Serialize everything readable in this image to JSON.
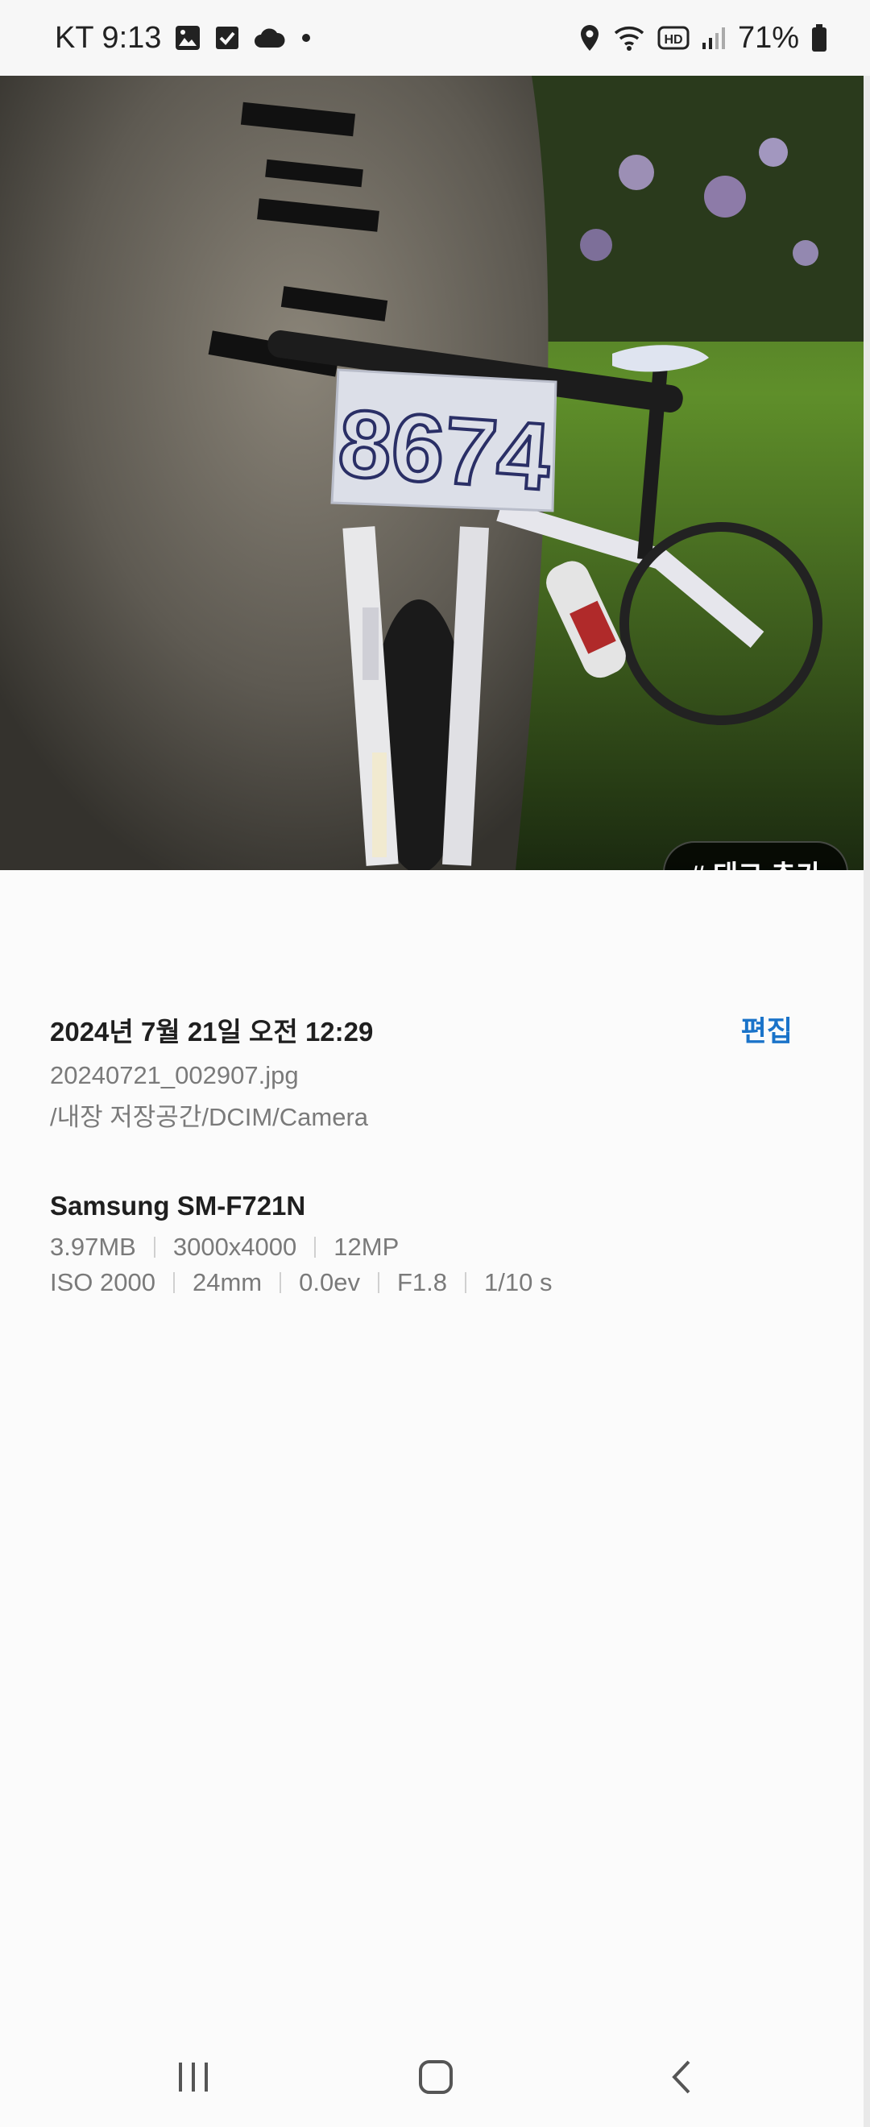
{
  "status_bar": {
    "carrier_time": "KT 9:13",
    "battery_percent": "71%",
    "icons": [
      "gallery-icon",
      "checkbox-icon",
      "cloud-icon",
      "dot-icon",
      "location-icon",
      "wifi-icon",
      "hd-icon",
      "signal-icon",
      "battery-icon"
    ]
  },
  "photo": {
    "sign_text": "8674",
    "tag_button_label": "# 태그 추가"
  },
  "details": {
    "datetime": "2024년 7월 21일 오전 12:29",
    "edit_label": "편집",
    "filename": "20240721_002907.jpg",
    "path": "/내장 저장공간/DCIM/Camera",
    "device": "Samsung SM-F721N",
    "file_specs": [
      "3.97MB",
      "3000x4000",
      "12MP"
    ],
    "camera_specs": [
      "ISO 2000",
      "24mm",
      "0.0ev",
      "F1.8",
      "1/10 s"
    ]
  },
  "nav": {
    "icons": [
      "recents-icon",
      "home-icon",
      "back-icon"
    ]
  }
}
